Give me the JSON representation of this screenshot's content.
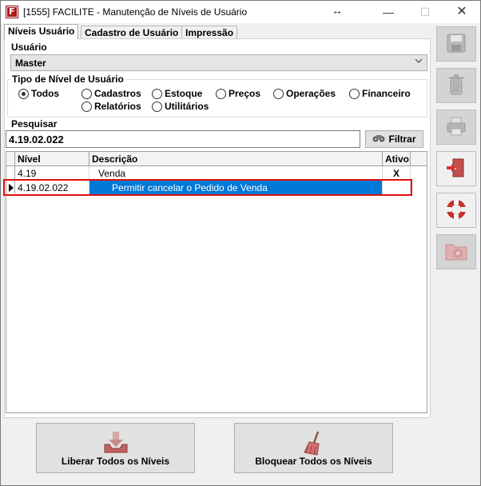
{
  "window": {
    "title": "[1555] FACILITE - Manutenção de Níveis de Usuário"
  },
  "tabs": [
    {
      "label": "Níveis Usuário",
      "active": true
    },
    {
      "label": "Cadastro de Usuário",
      "active": false
    },
    {
      "label": "Impressão",
      "active": false
    }
  ],
  "user": {
    "label": "Usuário",
    "selected": "Master"
  },
  "level_type": {
    "label": "Tipo de Nível de Usuário",
    "options": [
      {
        "label": "Todos",
        "checked": true
      },
      {
        "label": "Cadastros",
        "checked": false
      },
      {
        "label": "Estoque",
        "checked": false
      },
      {
        "label": "Preços",
        "checked": false
      },
      {
        "label": "Operações",
        "checked": false
      },
      {
        "label": "Financeiro",
        "checked": false
      },
      {
        "label": "Relatórios",
        "checked": false
      },
      {
        "label": "Utilitários",
        "checked": false
      }
    ]
  },
  "search": {
    "label": "Pesquisar",
    "value": "4.19.02.022",
    "filter_label": "Filtrar"
  },
  "grid": {
    "columns": [
      "Nível",
      "Descrição",
      "Ativo"
    ],
    "rows": [
      {
        "nivel": "4.19",
        "descricao": "Venda",
        "ativo": "X"
      },
      {
        "nivel": "4.19.02.022",
        "descricao": "Permitir cancelar o Pedido de Venda",
        "ativo": ""
      }
    ]
  },
  "toolbar": [
    {
      "icon": "save-icon",
      "enabled": false
    },
    {
      "icon": "trash-icon",
      "enabled": false
    },
    {
      "icon": "printer-icon",
      "enabled": false
    },
    {
      "icon": "exit-door-icon",
      "enabled": true
    },
    {
      "icon": "lifebuoy-icon",
      "enabled": true
    },
    {
      "icon": "settings-folder-icon",
      "enabled": false
    }
  ],
  "actions": {
    "release_all": "Liberar Todos os Níveis",
    "block_all": "Bloquear Todos os Níveis"
  },
  "colors": {
    "selection": "#0078d7",
    "highlight": "#e01010"
  }
}
